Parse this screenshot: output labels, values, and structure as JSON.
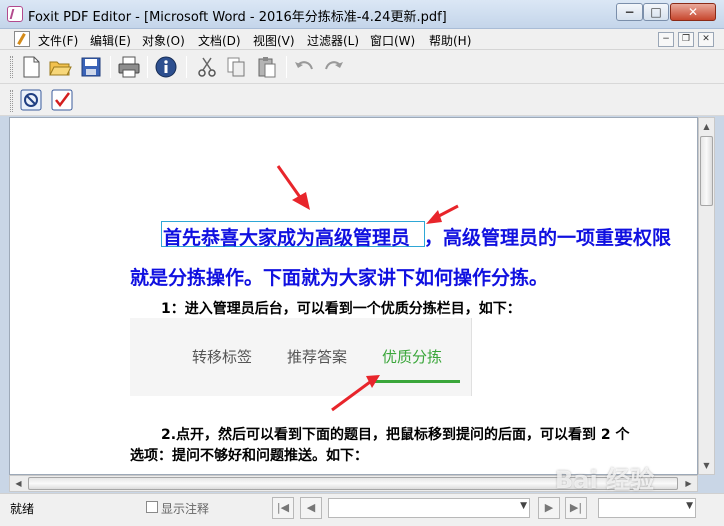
{
  "window": {
    "title": "Foxit PDF Editor - [Microsoft Word - 2016年分拣标准-4.24更新.pdf]",
    "minimize": "−",
    "maximize": "□",
    "close": "✕"
  },
  "menu": {
    "items": [
      "文件(F)",
      "编辑(E)",
      "对象(O)",
      "文档(D)",
      "视图(V)",
      "过滤器(L)",
      "窗口(W)",
      "帮助(H)"
    ]
  },
  "toolbar": {
    "icons": [
      "new-document-icon",
      "open-folder-icon",
      "save-icon",
      "print-icon",
      "info-icon",
      "cut-icon",
      "copy-icon",
      "paste-icon",
      "undo-icon",
      "redo-icon"
    ],
    "icons2": [
      "stop-icon",
      "checkmark-icon"
    ]
  },
  "document": {
    "line1_selected": "首先恭喜大家成为高级管理员",
    "line1_rest": "，高级管理员的一项重要权限",
    "line2": "就是分拣操作。下面就为大家讲下如何操作分拣。",
    "step1": "1：进入管理员后台，可以看到一个优质分拣栏目，如下：",
    "tabs": [
      "转移标签",
      "推荐答案",
      "优质分拣"
    ],
    "active_tab": "优质分拣",
    "step2_line1": "2.点开，然后可以看到下面的题目，把鼠标移到提问的后面，可以看到 2 个",
    "step2_line2": "选项：提问不够好和问题推送。如下："
  },
  "status": {
    "text": "就绪",
    "show_annotations": "显示注释",
    "page_value": "",
    "zoom_value": ""
  },
  "watermark": "Bai 经验",
  "colors": {
    "doc_text_blue": "#1010e0",
    "selection_border": "#2ea7d6",
    "active_tab_green": "#3aa63a",
    "arrow_red": "#e8252b"
  }
}
